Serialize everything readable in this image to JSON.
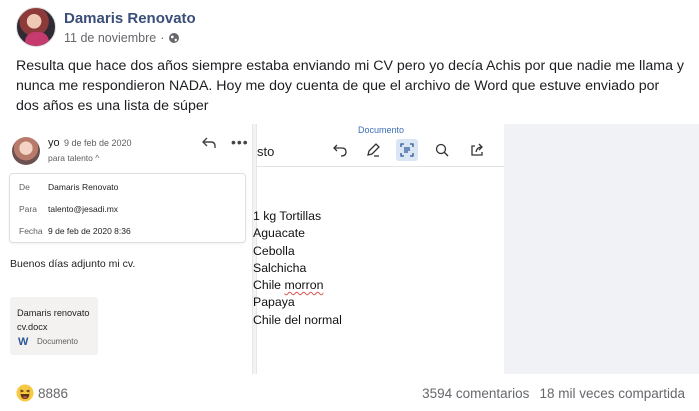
{
  "post": {
    "author": "Damaris Renovato",
    "date": "11 de noviembre",
    "separator": "·",
    "text": "Resulta que hace dos años siempre estaba enviando mi CV pero yo decía Achis por que nadie me llama y nunca me respondieron NADA. Hoy me doy cuenta de que el archivo de Word que estuve enviado por dos años es una lista de súper"
  },
  "email": {
    "from": "yo",
    "date": "9 de feb de 2020",
    "to_line": "para talento ^",
    "fields": [
      {
        "label": "De",
        "value": "Damaris Renovato"
      },
      {
        "label": "Para",
        "value": "talento@jesadi.mx"
      },
      {
        "label": "Fecha",
        "value": "9 de feb de 2020 8:36"
      }
    ],
    "body": "Buenos días adjunto mi cv.",
    "attachment": {
      "name": "Damaris renovato cv.docx",
      "kind": "Documento",
      "icon_letter": "W"
    }
  },
  "document": {
    "title": "Documento",
    "partial_text": "sto",
    "items": [
      "1 kg Tortillas",
      "Aguacate",
      "Cebolla",
      "Salchicha",
      "Chile morron",
      "Papaya",
      "Chile del normal"
    ],
    "misspelled": "morron"
  },
  "footer": {
    "reaction_count": "8886",
    "comments": "3594 comentarios",
    "shares": "18 mil veces compartida"
  },
  "colors": {
    "author": "#3a4e78",
    "muted": "#65676b",
    "accent": "#3b6fb6"
  }
}
